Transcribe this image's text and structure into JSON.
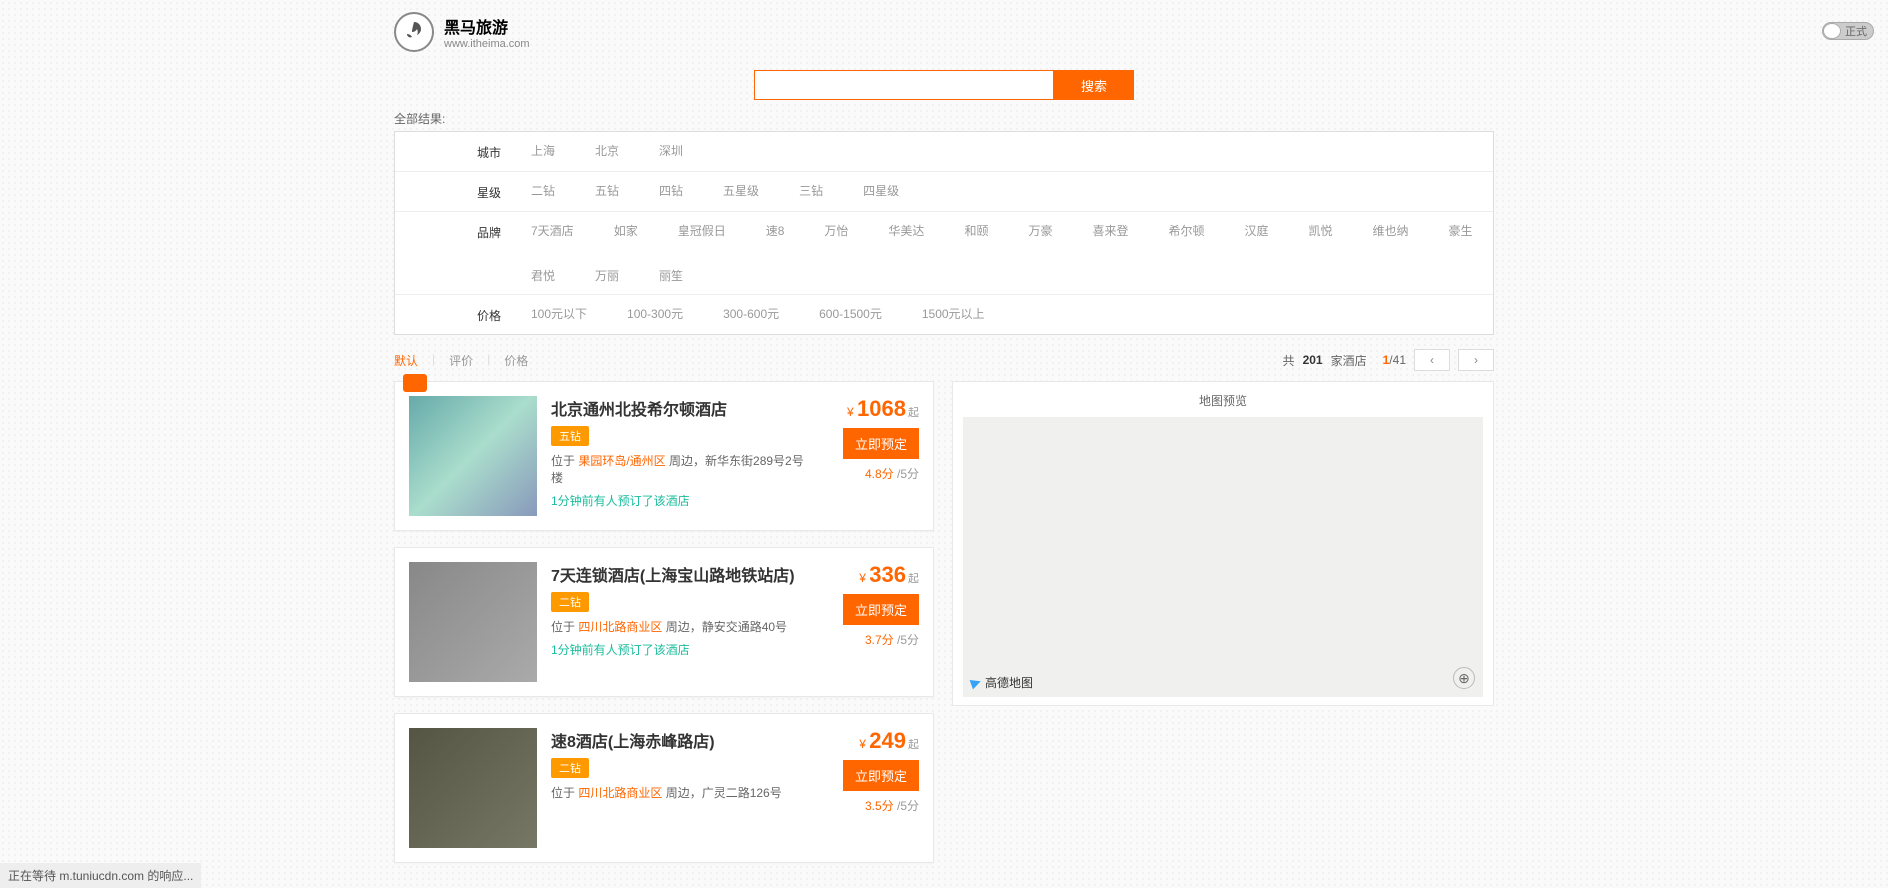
{
  "header": {
    "title": "黑马旅游",
    "sub": "www.itheima.com"
  },
  "mode_toggle": "正式",
  "search": {
    "button": "搜索",
    "value": ""
  },
  "results_label": "全部结果:",
  "filters": {
    "city": {
      "label": "城市",
      "opts": [
        "上海",
        "北京",
        "深圳"
      ]
    },
    "star": {
      "label": "星级",
      "opts": [
        "二钻",
        "五钻",
        "四钻",
        "五星级",
        "三钻",
        "四星级"
      ]
    },
    "brand": {
      "label": "品牌",
      "opts": [
        "7天酒店",
        "如家",
        "皇冠假日",
        "速8",
        "万怡",
        "华美达",
        "和颐",
        "万豪",
        "喜来登",
        "希尔顿",
        "汉庭",
        "凯悦",
        "维也纳",
        "豪生",
        "君悦",
        "万丽",
        "丽笙"
      ]
    },
    "price": {
      "label": "价格",
      "opts": [
        "100元以下",
        "100-300元",
        "300-600元",
        "600-1500元",
        "1500元以上"
      ]
    }
  },
  "sort": {
    "tabs": [
      "默认",
      "评价",
      "价格"
    ],
    "active_index": 0,
    "total_prefix": "共 ",
    "total_count": "201",
    "total_suffix": " 家酒店",
    "page_cur": "1",
    "page_sep": "/",
    "page_total": "41"
  },
  "hotels": [
    {
      "name": "北京通州北投希尔顿酒店",
      "star": "五钻",
      "loc_prefix": "位于 ",
      "loc_orange": "果园环岛/通州区",
      "loc_suffix": " 周边，新华东街289号2号楼",
      "recent": "1分钟前有人预订了该酒店",
      "price": "1068",
      "score": "4.8分",
      "score_max": " /5分",
      "book": "立即预定"
    },
    {
      "name": "7天连锁酒店(上海宝山路地铁站店)",
      "star": "二钻",
      "loc_prefix": "位于 ",
      "loc_orange": "四川北路商业区",
      "loc_suffix": " 周边，静安交通路40号",
      "recent": "1分钟前有人预订了该酒店",
      "price": "336",
      "score": "3.7分",
      "score_max": " /5分",
      "book": "立即预定"
    },
    {
      "name": "速8酒店(上海赤峰路店)",
      "star": "二钻",
      "loc_prefix": "位于 ",
      "loc_orange": "四川北路商业区",
      "loc_suffix": " 周边，广灵二路126号",
      "recent": "",
      "price": "249",
      "score": "3.5分",
      "score_max": " /5分",
      "book": "立即预定"
    }
  ],
  "map": {
    "title": "地图预览",
    "logo": "高德地图"
  },
  "price_labels": {
    "yen": "¥",
    "qi": "起"
  },
  "status": "正在等待 m.tuniucdn.com 的响应..."
}
